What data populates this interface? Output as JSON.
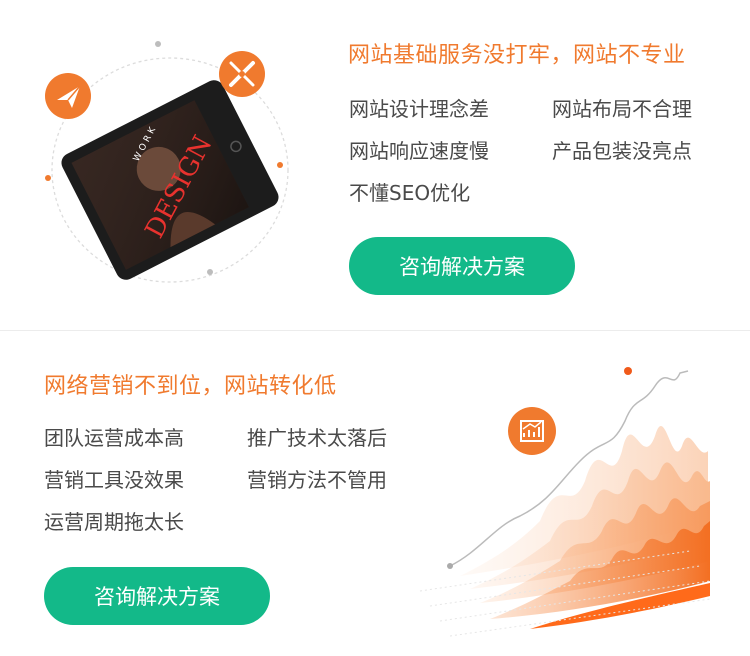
{
  "section1": {
    "heading": "网站基础服务没打牢，网站不专业",
    "items": [
      "网站设计理念差",
      "网站布局不合理",
      "网站响应速度慢",
      "产品包装没亮点",
      "不懂SEO优化"
    ],
    "cta_label": "咨询解决方案",
    "tablet_text": {
      "word": "WORK",
      "design": "DESIGN"
    }
  },
  "section2": {
    "heading": "网络营销不到位，网站转化低",
    "items": [
      "团队运营成本高",
      "推广技术太落后",
      "营销工具没效果",
      "营销方法不管用",
      "运营周期拖太长"
    ],
    "cta_label": "咨询解决方案"
  },
  "colors": {
    "accent_orange": "#f07a2e",
    "cta_green": "#13b989",
    "text_gray": "#4a4a4a"
  },
  "icons": [
    "paper-plane-icon",
    "design-tools-icon",
    "growth-chart-icon"
  ]
}
